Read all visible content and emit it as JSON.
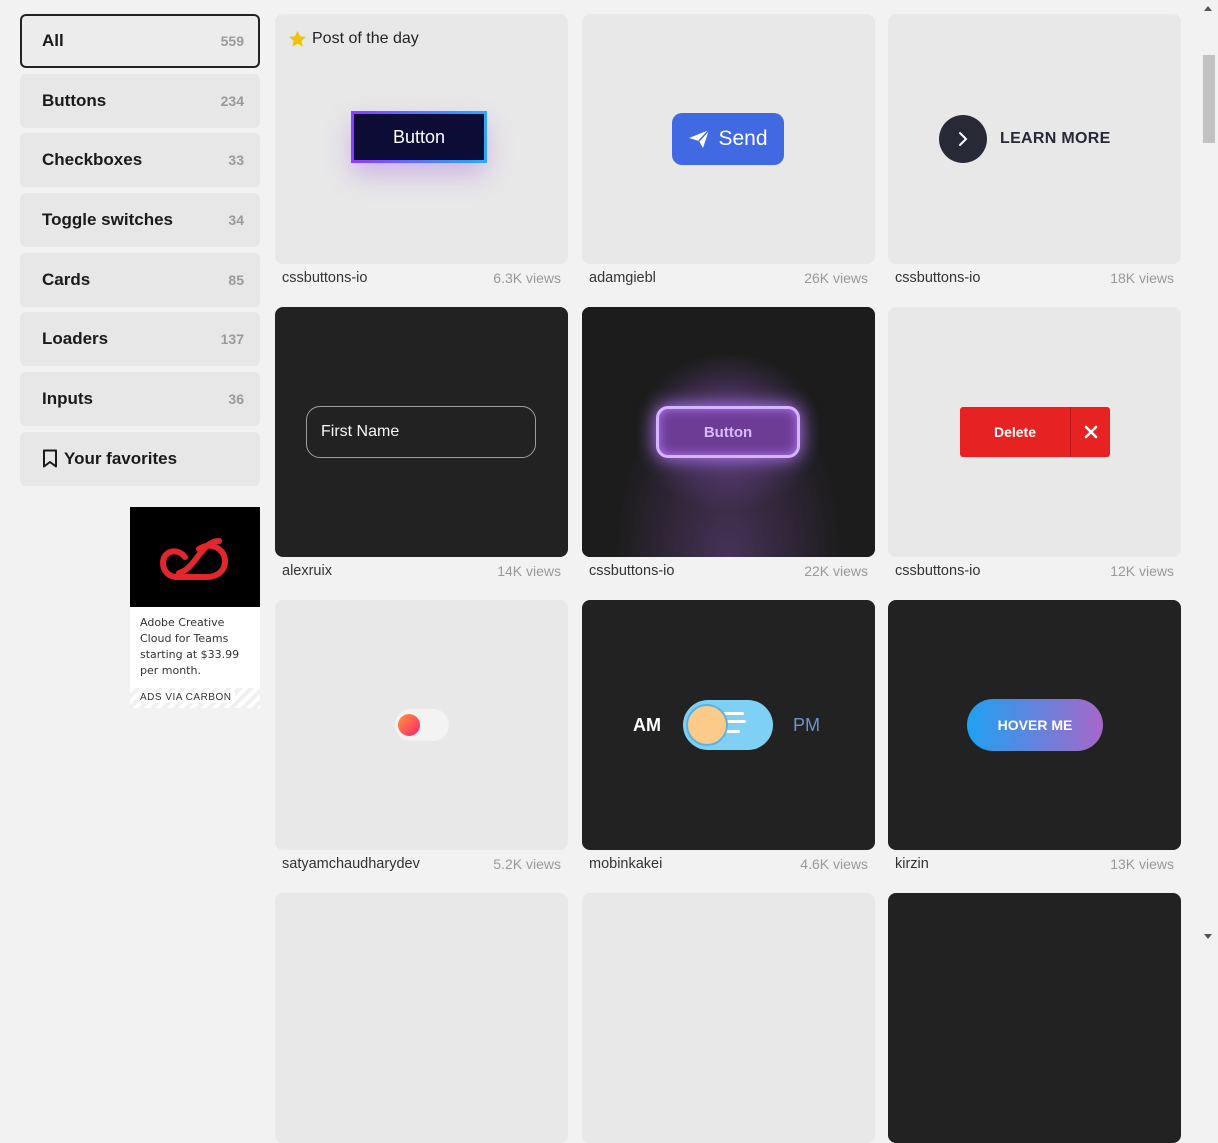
{
  "sidebar": {
    "categories": [
      {
        "label": "All",
        "count": "559"
      },
      {
        "label": "Buttons",
        "count": "234"
      },
      {
        "label": "Checkboxes",
        "count": "33"
      },
      {
        "label": "Toggle switches",
        "count": "34"
      },
      {
        "label": "Cards",
        "count": "85"
      },
      {
        "label": "Loaders",
        "count": "137"
      },
      {
        "label": "Inputs",
        "count": "36"
      }
    ],
    "favorites_label": "Your favorites"
  },
  "ad": {
    "text": "Adobe Creative Cloud for Teams starting at $33.99 per month.",
    "footer": "ADS VIA CARBON"
  },
  "post_of_day_label": "Post of the day",
  "cards": [
    {
      "author": "cssbuttons-io",
      "views": "6.3K views",
      "content": "Button"
    },
    {
      "author": "adamgiebl",
      "views": "26K views",
      "content": "Send"
    },
    {
      "author": "cssbuttons-io",
      "views": "18K views",
      "content": "LEARN MORE"
    },
    {
      "author": "alexruix",
      "views": "14K views",
      "content": "First Name"
    },
    {
      "author": "cssbuttons-io",
      "views": "22K views",
      "content": "Button"
    },
    {
      "author": "cssbuttons-io",
      "views": "12K views",
      "content": "Delete"
    },
    {
      "author": "satyamchaudharydev",
      "views": "5.2K views"
    },
    {
      "author": "mobinkakei",
      "views": "4.6K views",
      "am": "AM",
      "pm": "PM"
    },
    {
      "author": "kirzin",
      "views": "13K views",
      "content": "HOVER ME"
    }
  ],
  "colors": {
    "accent_blue": "#4169e1",
    "delete_red": "#e62222",
    "dark_card": "#222222",
    "light_card": "#e8e8e8"
  }
}
